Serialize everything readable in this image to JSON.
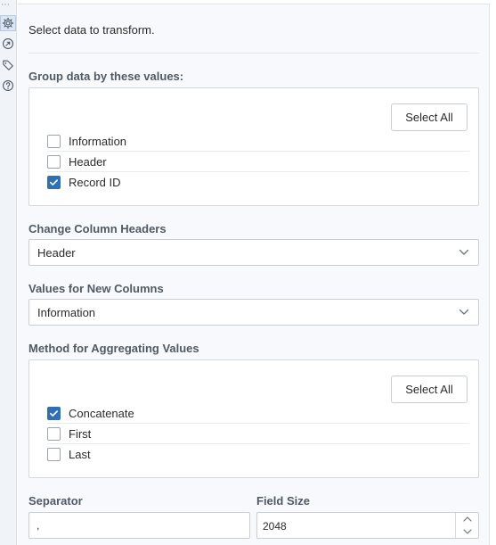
{
  "rail": {
    "overflow": "⋯",
    "icons": [
      "settings-gear-icon",
      "annotation-arrow-icon",
      "tag-icon",
      "help-icon"
    ]
  },
  "intro": "Select data to transform.",
  "group": {
    "label": "Group data by these values:",
    "select_all": "Select All",
    "options": [
      {
        "label": "Information",
        "checked": false
      },
      {
        "label": "Header",
        "checked": false
      },
      {
        "label": "Record ID",
        "checked": true
      }
    ]
  },
  "change_headers": {
    "label": "Change Column Headers",
    "value": "Header"
  },
  "new_columns": {
    "label": "Values for New Columns",
    "value": "Information"
  },
  "aggregate": {
    "label": "Method for Aggregating Values",
    "select_all": "Select All",
    "options": [
      {
        "label": "Concatenate",
        "checked": true
      },
      {
        "label": "First",
        "checked": false
      },
      {
        "label": "Last",
        "checked": false
      }
    ]
  },
  "separator": {
    "label": "Separator",
    "value": ","
  },
  "field_size": {
    "label": "Field Size",
    "value": "2048"
  },
  "colors": {
    "accent": "#2f6fb5",
    "panel_bg": "#f7f9fc",
    "label_text": "#505a66"
  }
}
